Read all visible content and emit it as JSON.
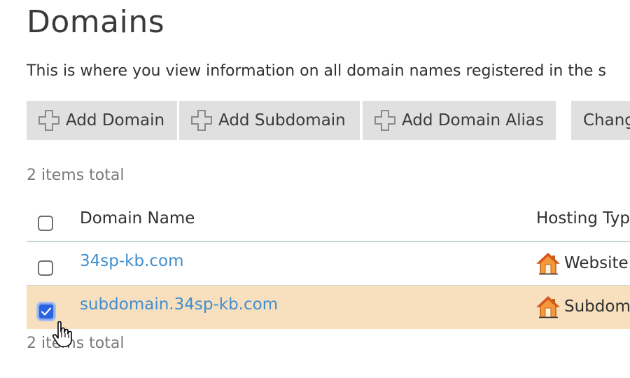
{
  "page": {
    "title": "Domains",
    "description": "This is where you view information on all domain names registered in the s"
  },
  "toolbar": {
    "buttons": [
      {
        "label": "Add Domain",
        "icon": "plus-icon"
      },
      {
        "label": "Add Subdomain",
        "icon": "plus-icon"
      },
      {
        "label": "Add Domain Alias",
        "icon": "plus-icon"
      },
      {
        "label": "Chang",
        "icon": null
      }
    ]
  },
  "summary": {
    "top": "2 items total",
    "bottom": "2 items total"
  },
  "table": {
    "columns": [
      "Domain Name",
      "Hosting Typ"
    ],
    "rows": [
      {
        "name": "34sp-kb.com",
        "hosting_type": "Website",
        "checked": false,
        "icon": "house-icon"
      },
      {
        "name": "subdomain.34sp-kb.com",
        "hosting_type": "Subdom",
        "checked": true,
        "icon": "house-icon"
      }
    ]
  },
  "colors": {
    "accent_link": "#3f8fd0",
    "selected_row": "#f8dfbd",
    "toolbar_button": "#e0e0e0",
    "checkbox_checked": "#2a63e0"
  }
}
